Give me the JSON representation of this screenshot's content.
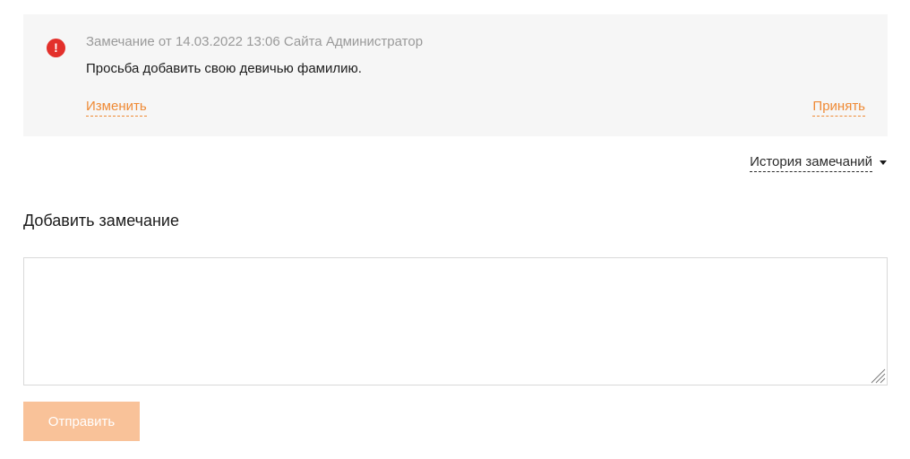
{
  "notice": {
    "icon": "exclamation-icon",
    "icon_glyph": "!",
    "meta": "Замечание от 14.03.2022 13:06 Сайта Администратор",
    "text": "Просьба добавить свою девичью фамилию.",
    "edit_label": "Изменить",
    "accept_label": "Принять"
  },
  "history": {
    "label": "История замечаний",
    "icon": "caret-down-icon"
  },
  "add_comment": {
    "title": "Добавить замечание",
    "value": "",
    "submit_label": "Отправить"
  },
  "colors": {
    "accent": "#ef8a35",
    "alert": "#e3302b",
    "button_disabled": "#f9c299",
    "panel_bg": "#f6f6f6"
  }
}
